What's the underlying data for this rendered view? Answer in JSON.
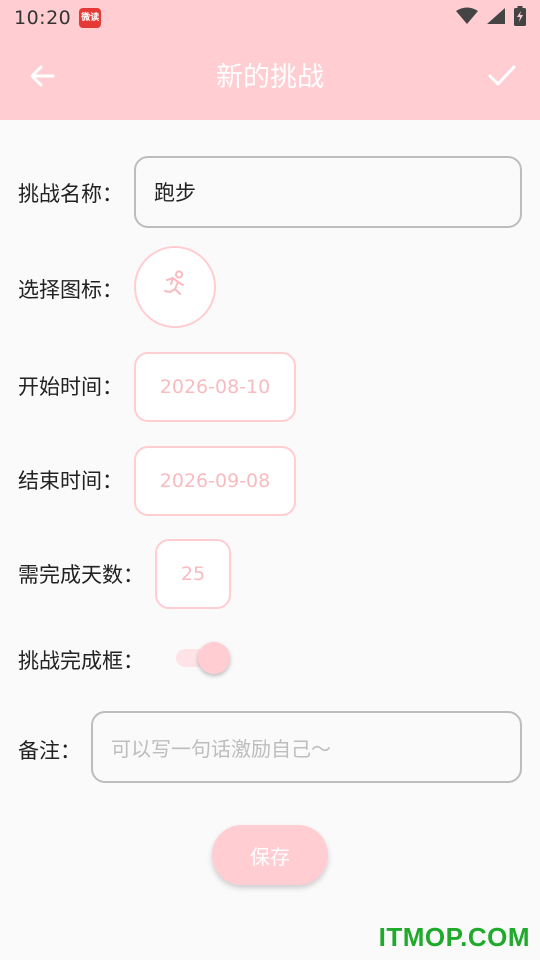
{
  "status_bar": {
    "time": "10:20",
    "app_badge": "微读",
    "icons": [
      "wifi-icon",
      "signal-icon",
      "battery-charging-icon"
    ]
  },
  "app_bar": {
    "title": "新的挑战",
    "back_icon": "arrow-left-icon",
    "confirm_icon": "check-icon",
    "color": "#ffcdd2"
  },
  "form": {
    "name": {
      "label": "挑战名称：",
      "value": "跑步"
    },
    "icon": {
      "label": "选择图标：",
      "selected_icon": "running-person-icon"
    },
    "start_date": {
      "label": "开始时间：",
      "value": "2026-08-10"
    },
    "end_date": {
      "label": "结束时间：",
      "value": "2026-09-08"
    },
    "days_required": {
      "label": "需完成天数：",
      "value": "25"
    },
    "completion_box": {
      "label": "挑战完成框：",
      "enabled": true
    },
    "note": {
      "label": "备注：",
      "placeholder": "可以写一句话激励自己～"
    }
  },
  "save_button": {
    "label": "保存"
  },
  "watermark": "ITMOP.COM",
  "colors": {
    "accent": "#ffcdd2",
    "accent_text": "#f8bbc0",
    "background": "#fafafa",
    "watermark": "#1faa2b"
  }
}
